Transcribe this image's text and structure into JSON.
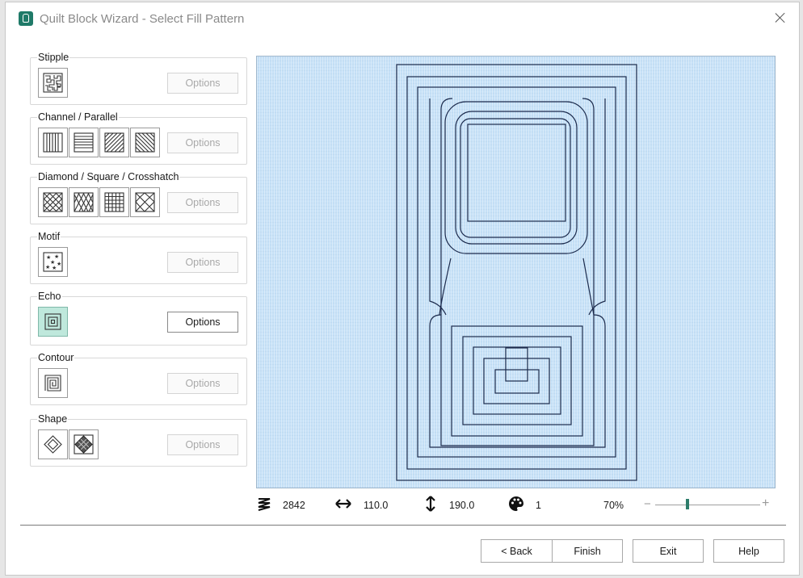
{
  "window": {
    "title": "Quilt Block Wizard - Select Fill Pattern"
  },
  "groups": [
    {
      "label": "Stipple",
      "options_label": "Options",
      "swatches": [
        "stipple-pattern-icon"
      ]
    },
    {
      "label": "Channel / Parallel",
      "options_label": "Options",
      "swatches": [
        "vertical-lines-icon",
        "horizontal-lines-icon",
        "diagonal-lines-icon",
        "diagonal-lines-reverse-icon"
      ]
    },
    {
      "label": "Diamond / Square / Crosshatch",
      "options_label": "Options",
      "swatches": [
        "diamond-crosshatch-icon",
        "narrow-diamond-icon",
        "square-grid-icon",
        "curved-diamond-icon"
      ]
    },
    {
      "label": "Motif",
      "options_label": "Options",
      "swatches": [
        "star-motif-icon"
      ]
    },
    {
      "label": "Echo",
      "options_label": "Options",
      "swatches": [
        "echo-squares-icon"
      ],
      "selected": true
    },
    {
      "label": "Contour",
      "options_label": "Options",
      "swatches": [
        "contour-spiral-icon"
      ]
    },
    {
      "label": "Shape",
      "options_label": "Options",
      "swatches": [
        "diamond-shape-icon",
        "filled-diamond-icon"
      ]
    }
  ],
  "status": {
    "stitches": "2842",
    "width": "110.0",
    "height": "190.0",
    "colors": "1",
    "zoom": "70%",
    "zoom_level": 0.31
  },
  "buttons": {
    "back": "< Back",
    "finish": "Finish",
    "exit": "Exit",
    "help": "Help"
  },
  "colors": {
    "accent": "#2e7d6b",
    "selected_swatch": "#bfe8dc",
    "preview_bg": "#c6e1f7",
    "stitch": "#1c2b4d"
  },
  "icons": {
    "stitch_count": "zigzag-stitch-icon",
    "width": "horizontal-arrow-icon",
    "height": "vertical-arrow-icon",
    "colors": "palette-icon"
  }
}
